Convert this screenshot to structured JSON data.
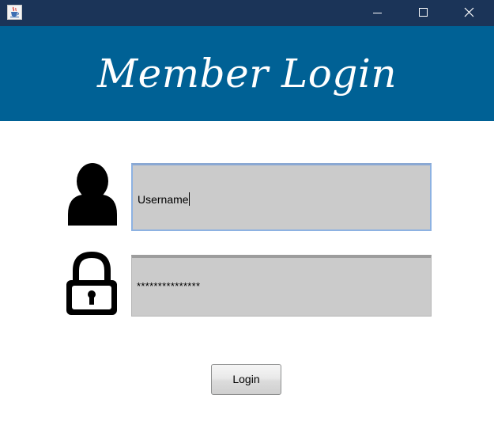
{
  "window": {
    "app_icon": "java-cup-icon",
    "controls": [
      "minimize-icon",
      "maximize-icon",
      "close-icon"
    ],
    "colors": {
      "titlebar": "#1b3458"
    }
  },
  "header": {
    "title": "Member Login",
    "colors": {
      "background": "#006195",
      "text": "#ffffff"
    }
  },
  "form": {
    "username": {
      "icon": "user-icon",
      "value": "Username"
    },
    "password": {
      "icon": "lock-icon",
      "value": "***************"
    },
    "login_label": "Login",
    "colors": {
      "field_background": "#cbcbcb",
      "focus_border": "#8db2e2"
    }
  }
}
